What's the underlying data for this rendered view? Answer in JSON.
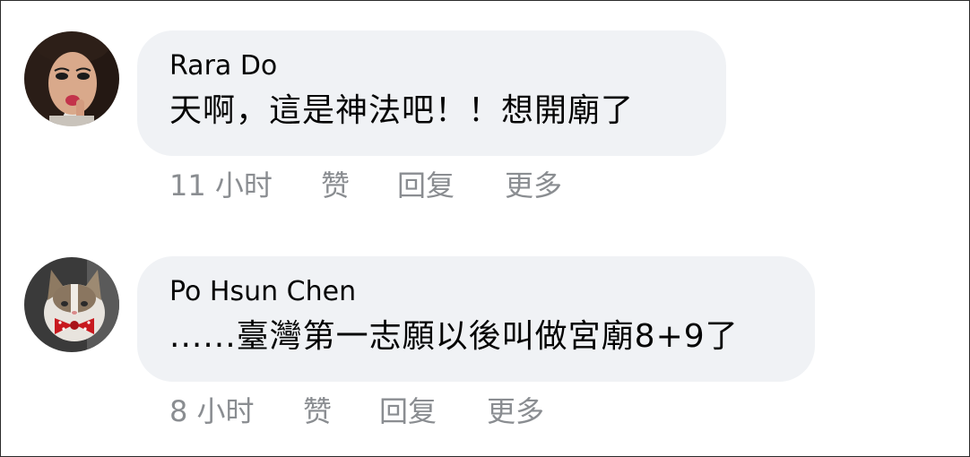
{
  "comments": [
    {
      "author": "Rara Do",
      "text": "天啊，這是神法吧！！想開廟了",
      "avatar": "woman-portrait-avatar",
      "time": "11 小时",
      "like": "赞",
      "reply": "回复",
      "more": "更多"
    },
    {
      "author": "Po Hsun Chen",
      "text": "......臺灣第一志願以後叫做宮廟8+9了",
      "avatar": "cat-with-bowtie-avatar",
      "time": "8 小时",
      "like": "赞",
      "reply": "回复",
      "more": "更多"
    }
  ],
  "colors": {
    "bubble": "#f0f2f5",
    "text": "#050505",
    "meta": "#8a8d91"
  }
}
